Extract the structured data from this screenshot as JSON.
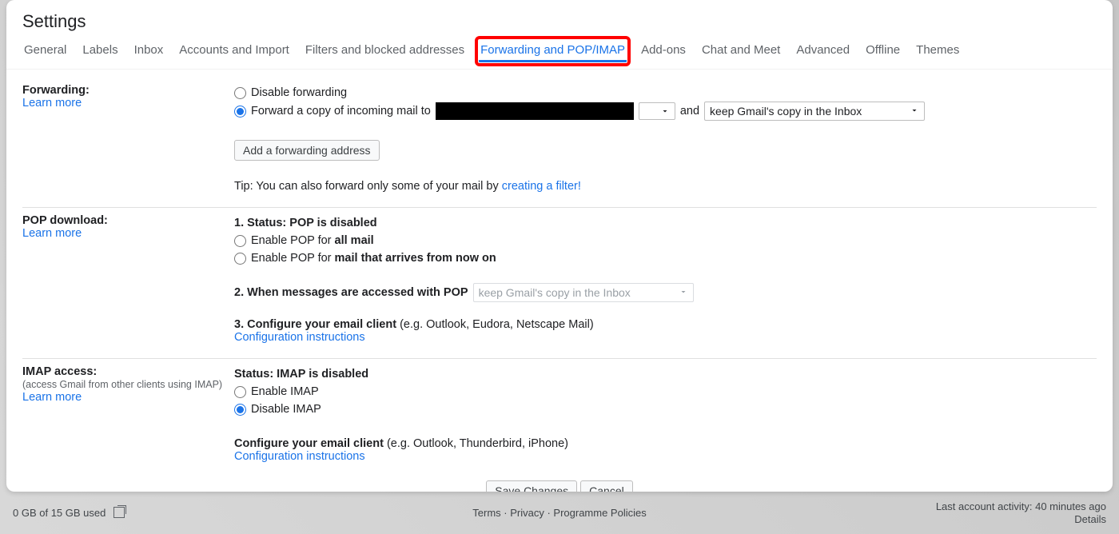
{
  "title": "Settings",
  "tabs": {
    "general": "General",
    "labels": "Labels",
    "inbox": "Inbox",
    "accounts": "Accounts and Import",
    "filters": "Filters and blocked addresses",
    "forwarding": "Forwarding and POP/IMAP",
    "addons": "Add-ons",
    "chat": "Chat and Meet",
    "advanced": "Advanced",
    "offline": "Offline",
    "themes": "Themes"
  },
  "forwarding": {
    "heading": "Forwarding:",
    "learn_more": "Learn more",
    "disable_label": "Disable forwarding",
    "forward_label": "Forward a copy of incoming mail to",
    "and": "and",
    "keep_option": "keep Gmail's copy in the Inbox",
    "add_address_btn": "Add a forwarding address",
    "tip_prefix": "Tip: You can also forward only some of your mail by ",
    "tip_link": "creating a filter!"
  },
  "pop": {
    "heading": "POP download:",
    "learn_more": "Learn more",
    "status_prefix": "1. Status: ",
    "status_value": "POP is disabled",
    "enable_all_prefix": "Enable POP for ",
    "enable_all_bold": "all mail",
    "enable_now_prefix": "Enable POP for ",
    "enable_now_bold": "mail that arrives from now on",
    "when_label": "2. When messages are accessed with POP",
    "when_option": "keep Gmail's copy in the Inbox",
    "configure_prefix": "3. Configure your email client ",
    "configure_example": "(e.g. Outlook, Eudora, Netscape Mail)",
    "config_link": "Configuration instructions"
  },
  "imap": {
    "heading": "IMAP access:",
    "sub": "(access Gmail from other clients using IMAP)",
    "learn_more": "Learn more",
    "status_prefix": "Status: ",
    "status_value": "IMAP is disabled",
    "enable_label": "Enable IMAP",
    "disable_label": "Disable IMAP",
    "configure_prefix": "Configure your email client ",
    "configure_example": "(e.g. Outlook, Thunderbird, iPhone)",
    "config_link": "Configuration instructions"
  },
  "actions": {
    "save": "Save Changes",
    "cancel": "Cancel"
  },
  "footer": {
    "storage": "0 GB of 15 GB used",
    "terms": "Terms",
    "privacy": "Privacy",
    "policies": "Programme Policies",
    "activity": "Last account activity: 40 minutes ago",
    "details": "Details"
  }
}
